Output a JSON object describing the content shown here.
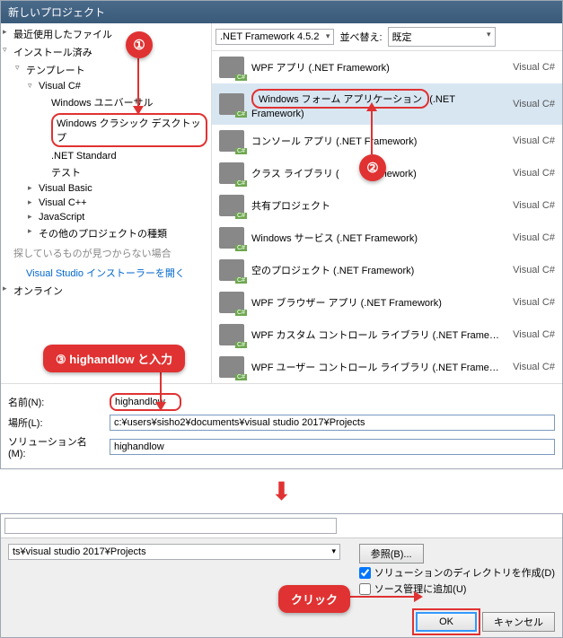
{
  "title": "新しいプロジェクト",
  "top": {
    "framework": ".NET Framework 4.5.2",
    "sort_label": "並べ替え:",
    "sort_value": "既定"
  },
  "sidebar": {
    "recent": "最近使用したファイル",
    "installed": "インストール済み",
    "templates": "テンプレート",
    "vcs": "Visual C#",
    "universal": "Windows ユニバーサル",
    "classic": "Windows クラシック デスクトップ",
    "netstd": ".NET Standard",
    "test": "テスト",
    "vb": "Visual Basic",
    "vcpp": "Visual C++",
    "js": "JavaScript",
    "others": "その他のプロジェクトの種類",
    "hint": "探しているものが見つからない場合",
    "open_installer": "Visual Studio インストーラーを開く",
    "online": "オンライン"
  },
  "templates": [
    {
      "label": "WPF アプリ (.NET Framework)",
      "lang": "Visual C#"
    },
    {
      "label_pre": "Windows フォーム アプリケーション",
      "label_post": "(.NET Framework)",
      "lang": "Visual C#"
    },
    {
      "label": "コンソール アプリ (.NET Framework)",
      "lang": "Visual C#"
    },
    {
      "label_pre": "クラス ライブラリ (",
      "label_post": "mework)",
      "lang": "Visual C#"
    },
    {
      "label": "共有プロジェクト",
      "lang": "Visual C#"
    },
    {
      "label": "Windows サービス (.NET Framework)",
      "lang": "Visual C#"
    },
    {
      "label": "空のプロジェクト (.NET Framework)",
      "lang": "Visual C#"
    },
    {
      "label": "WPF ブラウザー アプリ (.NET Framework)",
      "lang": "Visual C#"
    },
    {
      "label": "WPF カスタム コントロール ライブラリ (.NET Frame…",
      "lang": "Visual C#"
    },
    {
      "label": "WPF ユーザー コントロール ライブラリ (.NET Frame…",
      "lang": "Visual C#"
    }
  ],
  "fields": {
    "name_label": "名前(N):",
    "name_value": "highandlow",
    "loc_label": "場所(L):",
    "loc_value": "c:¥users¥sisho2¥documents¥visual studio 2017¥Projects",
    "sol_label": "ソリューション名(M):",
    "sol_value": "highandlow"
  },
  "callouts": {
    "num1": "①",
    "num2": "②",
    "num3": "③ highandlow と入力",
    "click": "クリック"
  },
  "dialog2": {
    "path_input": "",
    "path_drop": "ts¥visual studio 2017¥Projects",
    "browse": "参照(B)...",
    "cb1": "ソリューションのディレクトリを作成(D)",
    "cb2": "ソース管理に追加(U)",
    "ok": "OK",
    "cancel": "キャンセル"
  }
}
